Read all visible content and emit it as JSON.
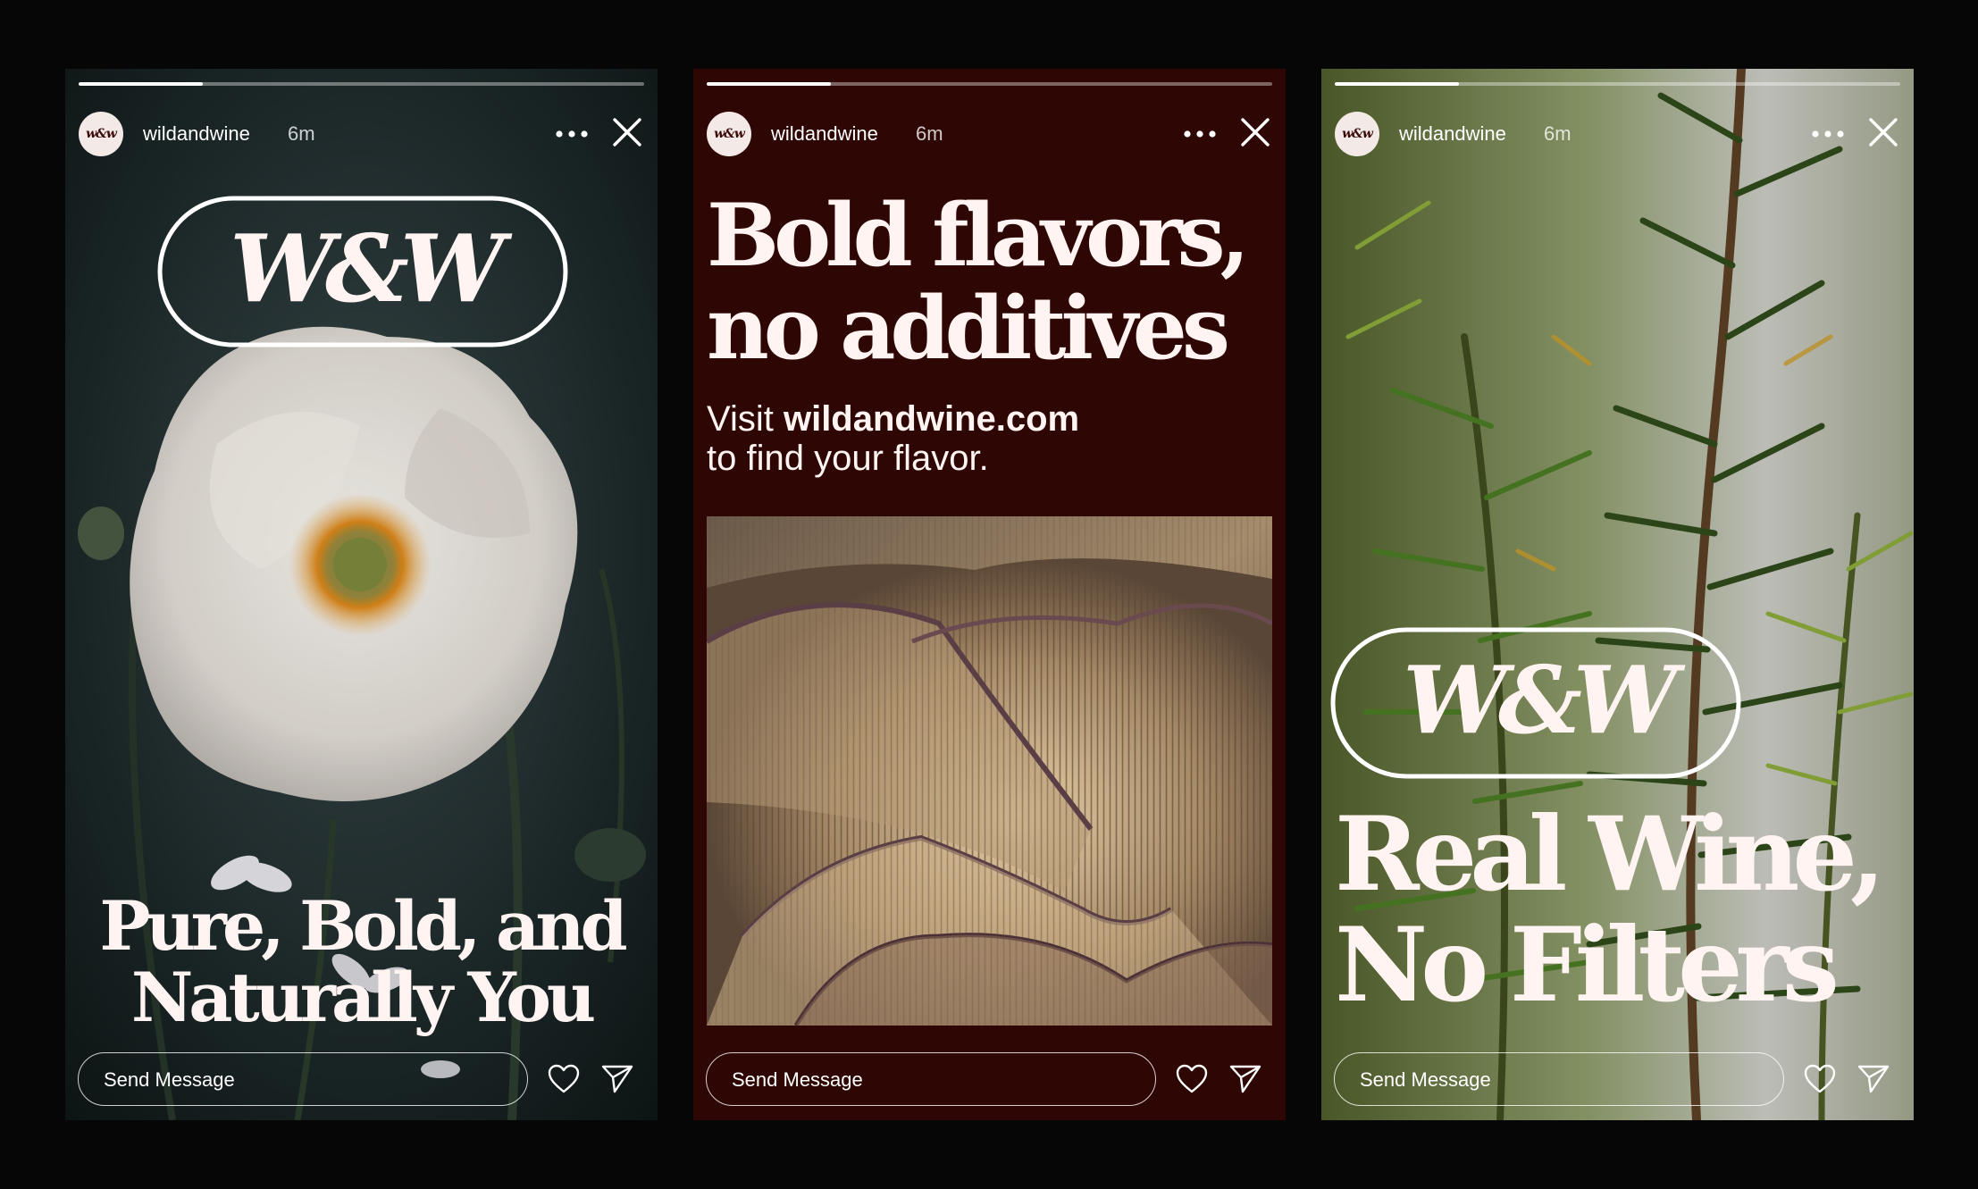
{
  "stories": [
    {
      "username": "wildandwine",
      "time": "6m",
      "avatar_text": "w&w",
      "logo_text": "W&W",
      "headline_line1": "Pure, Bold, and",
      "headline_line2": "Naturally You",
      "message_placeholder": "Send Message",
      "progress": 0.22,
      "background": "white poppy flower on dark green foliage"
    },
    {
      "username": "wildandwine",
      "time": "6m",
      "avatar_text": "w&w",
      "headline_line1": "Bold flavors,",
      "headline_line2": "no additives",
      "visit_prefix": "Visit",
      "website": "wildandwine.com",
      "visit_suffix": "to find your flavor.",
      "message_placeholder": "Send Message",
      "progress": 0.22,
      "photo": "mushroom gills close-up"
    },
    {
      "username": "wildandwine",
      "time": "6m",
      "avatar_text": "w&w",
      "logo_text": "W&W",
      "headline_line1": "Real Wine,",
      "headline_line2": "No Filters",
      "message_placeholder": "Send Message",
      "progress": 0.22,
      "background": "rosemary branches"
    }
  ],
  "colors": {
    "page_background": "#060606",
    "wine_red": "#2e0604",
    "cream": "#fff4f1"
  },
  "icons": [
    "more-icon",
    "close-icon",
    "heart-icon",
    "send-icon"
  ]
}
